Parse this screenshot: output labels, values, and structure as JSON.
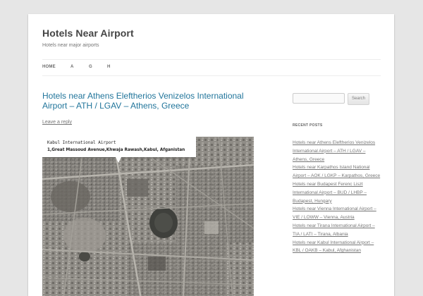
{
  "site": {
    "title": "Hotels Near Airport",
    "description": "Hotels near major airports"
  },
  "nav": {
    "items": [
      {
        "label": "Home"
      },
      {
        "label": "A"
      },
      {
        "label": "G"
      },
      {
        "label": "H"
      }
    ]
  },
  "post": {
    "title": "Hotels near Athens Eleftherios Venizelos International Airport – ATH / LGAV – Athens, Greece",
    "leave_reply": "Leave a reply"
  },
  "map": {
    "info_name": "Kabul International Airport",
    "info_address": "1,Great Massoud Avenue,Khwaja Rawash,Kabul, Afganistan",
    "marker_icon": "map-pin-icon"
  },
  "sidebar": {
    "search_placeholder": "",
    "search_button": "Search",
    "recent_title": "Recent Posts",
    "recent_posts": [
      "Hotels near Athens Eleftherios Venizelos International Airport – ATH / LGAV – Athens, Greece",
      "Hotels near Karpathos Island National Airport – AOK / LGKP – Karpathos, Greece",
      "Hotels near Budapest Ferenc Liszt International Airport – BUD / LHBP – Budapest, Hungary",
      "Hotels near Vienna International Airport – VIE / LOWW – Vienna, Austria",
      "Hotels near Tirana International Airport – TIA / LATI – Tirana, Albania",
      "Hotels near Kabul International Airport – KBL / OAKB – Kabul, Afghanistan"
    ]
  },
  "colors": {
    "link": "#21759b",
    "background": "#e6e6e6",
    "text": "#444444"
  }
}
